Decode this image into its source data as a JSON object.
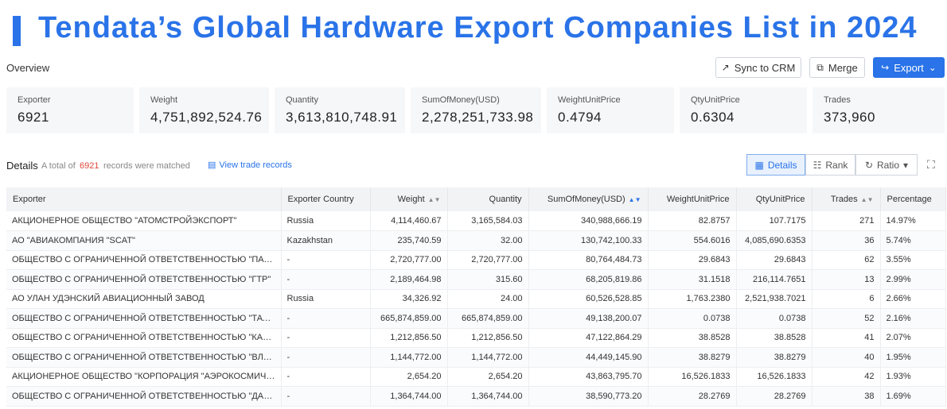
{
  "banner": {
    "title": "Tendata’s Global Hardware Export Companies List in 2024"
  },
  "overview": {
    "label": "Overview",
    "buttons": {
      "sync": "Sync to CRM",
      "merge": "Merge",
      "export": "Export"
    },
    "cards": [
      {
        "label": "Exporter",
        "value": "6921"
      },
      {
        "label": "Weight",
        "value": "4,751,892,524.76"
      },
      {
        "label": "Quantity",
        "value": "3,613,810,748.91"
      },
      {
        "label": "SumOfMoney(USD)",
        "value": "2,278,251,733.98"
      },
      {
        "label": "WeightUnitPrice",
        "value": "0.4794"
      },
      {
        "label": "QtyUnitPrice",
        "value": "0.6304"
      },
      {
        "label": "Trades",
        "value": "373,960"
      }
    ]
  },
  "details": {
    "title": "Details",
    "pre": "A total of",
    "count": "6921",
    "post": "records were matched",
    "view_link": "View trade records",
    "views": {
      "details": "Details",
      "rank": "Rank",
      "ratio": "Ratio"
    }
  },
  "table": {
    "headers": {
      "exporter": "Exporter",
      "country": "Exporter Country",
      "weight": "Weight",
      "quantity": "Quantity",
      "sum": "SumOfMoney(USD)",
      "wup": "WeightUnitPrice",
      "qup": "QtyUnitPrice",
      "trades": "Trades",
      "pct": "Percentage"
    },
    "rows": [
      {
        "exporter": "АКЦИОНЕРНОЕ ОБЩЕСТВО \"АТОМСТРОЙЭКСПОРТ\"",
        "country": "Russia",
        "weight": "4,114,460.67",
        "quantity": "3,165,584.03",
        "sum": "340,988,666.19",
        "wup": "82.8757",
        "qup": "107.7175",
        "trades": "271",
        "pct": "14.97%"
      },
      {
        "exporter": "АО \"АВИАКОМПАНИЯ \"SCAT\"",
        "country": "Kazakhstan",
        "weight": "235,740.59",
        "quantity": "32.00",
        "sum": "130,742,100.33",
        "wup": "554.6016",
        "qup": "4,085,690.6353",
        "trades": "36",
        "pct": "5.74%"
      },
      {
        "exporter": "ОБЩЕСТВО С ОГРАНИЧЕННОЙ ОТВЕТСТВЕННОСТЬЮ \"ПАСИФИК КР...",
        "country": "-",
        "weight": "2,720,777.00",
        "quantity": "2,720,777.00",
        "sum": "80,764,484.73",
        "wup": "29.6843",
        "qup": "29.6843",
        "trades": "62",
        "pct": "3.55%"
      },
      {
        "exporter": "ОБЩЕСТВО С ОГРАНИЧЕННОЙ ОТВЕТСТВЕННОСТЬЮ \"ГТР\"",
        "country": "-",
        "weight": "2,189,464.98",
        "quantity": "315.60",
        "sum": "68,205,819.86",
        "wup": "31.1518",
        "qup": "216,114.7651",
        "trades": "13",
        "pct": "2.99%"
      },
      {
        "exporter": "АО УЛАН УДЭНСКИЙ АВИАЦИОННЫЙ ЗАВОД",
        "country": "Russia",
        "weight": "34,326.92",
        "quantity": "24.00",
        "sum": "60,526,528.85",
        "wup": "1,763.2380",
        "qup": "2,521,938.7021",
        "trades": "6",
        "pct": "2.66%"
      },
      {
        "exporter": "ОБЩЕСТВО С ОГРАНИЧЕННОЙ ОТВЕТСТВЕННОСТЬЮ \"ТАТНЕФТЬ-А...",
        "country": "-",
        "weight": "665,874,859.00",
        "quantity": "665,874,859.00",
        "sum": "49,138,200.07",
        "wup": "0.0738",
        "qup": "0.0738",
        "trades": "52",
        "pct": "2.16%"
      },
      {
        "exporter": "ОБЩЕСТВО С ОГРАНИЧЕННОЙ ОТВЕТСТВЕННОСТЬЮ \"КАМЧАТКА К...",
        "country": "-",
        "weight": "1,212,856.50",
        "quantity": "1,212,856.50",
        "sum": "47,122,864.29",
        "wup": "38.8528",
        "qup": "38.8528",
        "trades": "41",
        "pct": "2.07%"
      },
      {
        "exporter": "ОБЩЕСТВО С ОГРАНИЧЕННОЙ ОТВЕТСТВЕННОСТЬЮ \"ВЛАДКРАБ\"",
        "country": "-",
        "weight": "1,144,772.00",
        "quantity": "1,144,772.00",
        "sum": "44,449,145.90",
        "wup": "38.8279",
        "qup": "38.8279",
        "trades": "40",
        "pct": "1.95%"
      },
      {
        "exporter": "АКЦИОНЕРНОЕ ОБЩЕСТВО \"КОРПОРАЦИЯ \"АЭРОКОСМИЧЕСКОЕ ОБ...",
        "country": "-",
        "weight": "2,654.20",
        "quantity": "2,654.20",
        "sum": "43,863,795.70",
        "wup": "16,526.1833",
        "qup": "16,526.1833",
        "trades": "42",
        "pct": "1.93%"
      },
      {
        "exporter": "ОБЩЕСТВО С ОГРАНИЧЕННОЙ ОТВЕТСТВЕННОСТЬЮ \"ДАЛЬНЕВОСТ...",
        "country": "-",
        "weight": "1,364,744.00",
        "quantity": "1,364,744.00",
        "sum": "38,590,773.20",
        "wup": "28.2769",
        "qup": "28.2769",
        "trades": "38",
        "pct": "1.69%"
      }
    ]
  }
}
